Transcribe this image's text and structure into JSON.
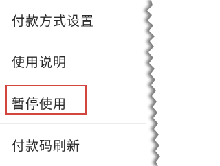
{
  "menu": {
    "items": [
      {
        "label": "付款方式设置"
      },
      {
        "label": "使用说明"
      },
      {
        "label": "暂停使用"
      },
      {
        "label": "付款码刷新"
      }
    ],
    "highlighted_index": 2
  },
  "colors": {
    "highlight_border": "#d2463f",
    "text": "#2b2b2b",
    "divider": "#ececec",
    "background": "#ffffff"
  }
}
